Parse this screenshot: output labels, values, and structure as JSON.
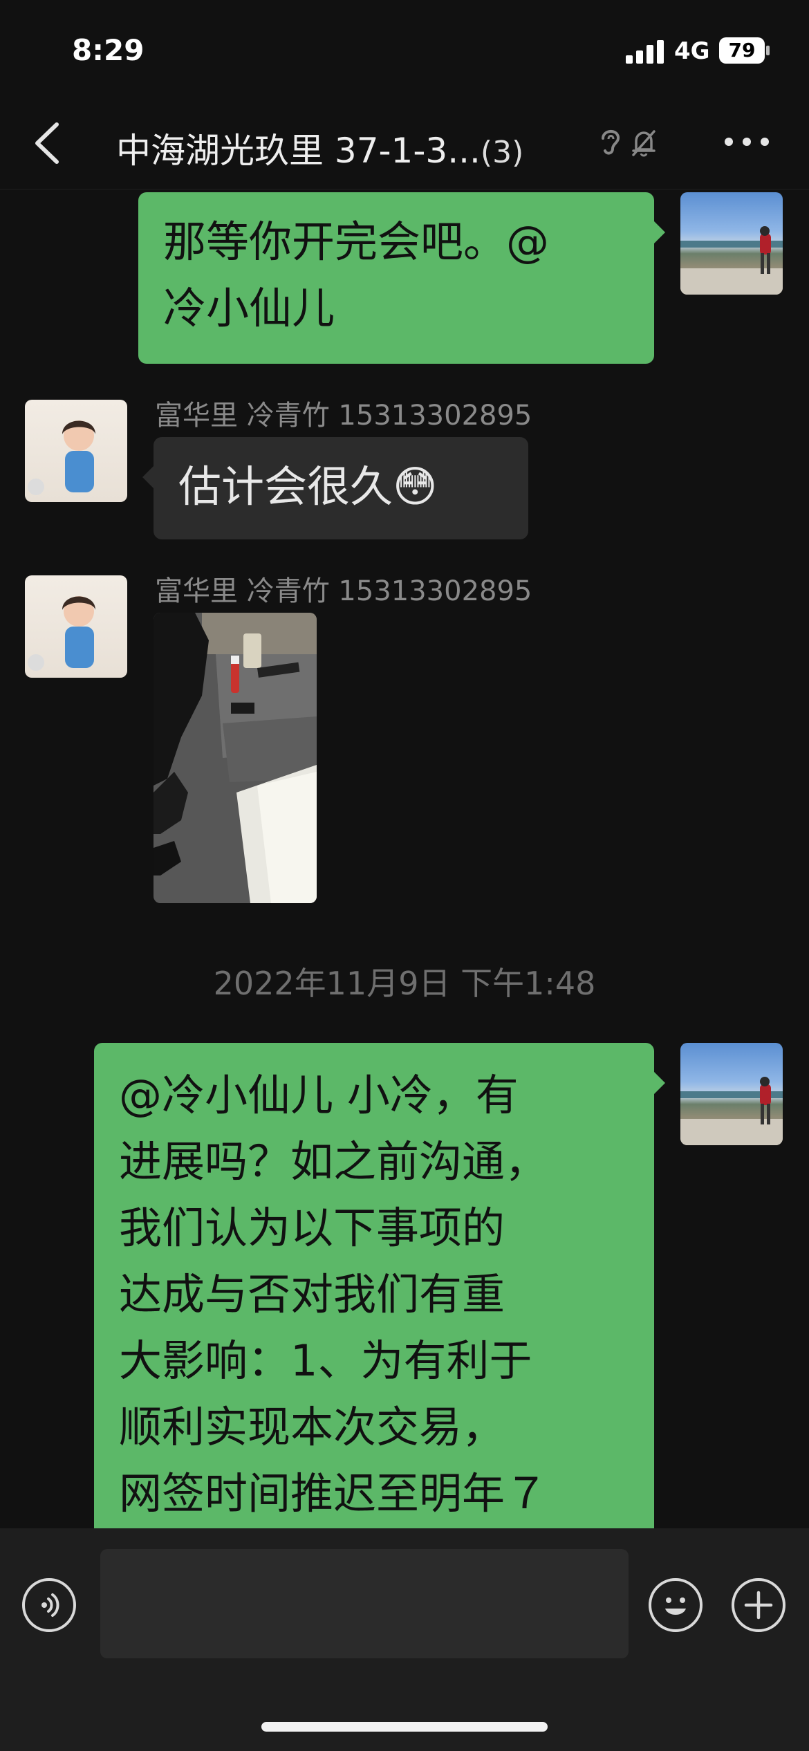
{
  "status_bar": {
    "time": "8:29",
    "network": "4G",
    "battery": "79"
  },
  "header": {
    "title": "中海湖光玖里 37-1-3...",
    "member_count": "(3)"
  },
  "messages": [
    {
      "side": "self",
      "text_lines": [
        "那等你开完会吧。@",
        "冷小仙儿"
      ]
    },
    {
      "side": "other",
      "sender": "富华里 冷青竹 15313302895",
      "text": "估计会很久",
      "emoji": "😳"
    },
    {
      "side": "other",
      "sender": "富华里 冷青竹 15313302895",
      "type": "image"
    },
    {
      "side": "self",
      "text_lines": [
        "@冷小仙儿 小冷，有",
        "进展吗？如之前沟通，",
        "我们认为以下事项的",
        "达成与否对我们有重",
        "大影响：1、为有利于",
        "顺利实现本次交易，",
        "网签时间推迟至明年７"
      ]
    }
  ],
  "timestamp": "2022年11月9日 下午1:48"
}
